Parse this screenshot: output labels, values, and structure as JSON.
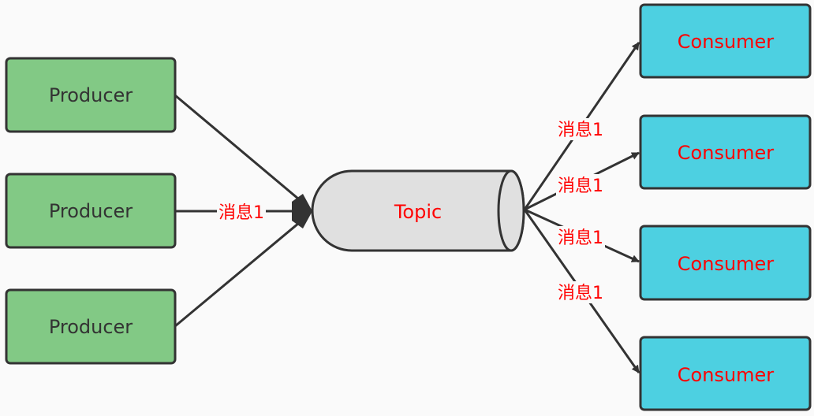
{
  "producers": [
    {
      "label": "Producer"
    },
    {
      "label": "Producer"
    },
    {
      "label": "Producer"
    }
  ],
  "topic": {
    "label": "Topic"
  },
  "consumers": [
    {
      "label": "Consumer"
    },
    {
      "label": "Consumer"
    },
    {
      "label": "Consumer"
    },
    {
      "label": "Consumer"
    }
  ],
  "edge_labels": {
    "producer_to_topic": "消息1",
    "topic_to_consumers": [
      "消息1",
      "消息1",
      "消息1",
      "消息1"
    ]
  },
  "colors": {
    "producer_fill": "#82c985",
    "consumer_fill": "#4dd0e1",
    "topic_fill": "#e0e0e0",
    "stroke": "#333333",
    "label_text": "#ff0000",
    "producer_text": "#333333"
  }
}
